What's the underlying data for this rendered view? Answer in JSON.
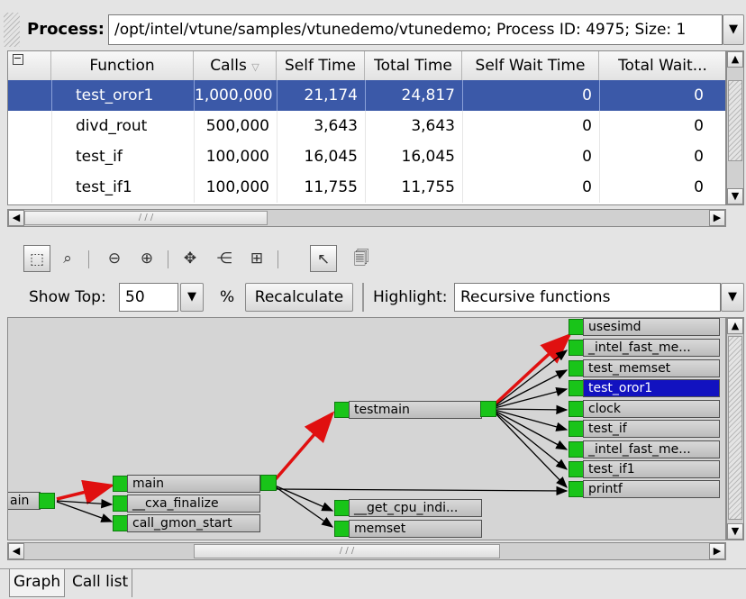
{
  "process": {
    "label": "Process:",
    "value": "/opt/intel/vtune/samples/vtunedemo/vtunedemo; Process ID: 4975; Size: 1"
  },
  "table": {
    "columns": [
      "Function",
      "Calls",
      "Self Time",
      "Total Time",
      "Self Wait Time",
      "Total Wait..."
    ],
    "rows": [
      {
        "function": "test_oror1",
        "calls": "1,000,000",
        "self_time": "21,174",
        "total_time": "24,817",
        "self_wait": "0",
        "total_wait": "0",
        "selected": true
      },
      {
        "function": "divd_rout",
        "calls": "500,000",
        "self_time": "3,643",
        "total_time": "3,643",
        "self_wait": "0",
        "total_wait": "0"
      },
      {
        "function": "test_if",
        "calls": "100,000",
        "self_time": "16,045",
        "total_time": "16,045",
        "self_wait": "0",
        "total_wait": "0"
      },
      {
        "function": "test_if1",
        "calls": "100,000",
        "self_time": "11,755",
        "total_time": "11,755",
        "self_wait": "0",
        "total_wait": "0"
      }
    ]
  },
  "controls": {
    "show_top_label": "Show Top:",
    "show_top_value": "50",
    "percent": "%",
    "recalculate": "Recalculate",
    "highlight_label": "Highlight:",
    "highlight_value": "Recursive functions"
  },
  "graph": {
    "nodes": {
      "ain": "ain",
      "main": "main",
      "cxa_finalize": "__cxa_finalize",
      "call_gmon_start": "call_gmon_start",
      "testmain": "testmain",
      "get_cpu_indi": "__get_cpu_indi...",
      "memset": "memset",
      "usesimd": "usesimd",
      "intel_fast_me1": "_intel_fast_me...",
      "test_memset": "test_memset",
      "test_oror1": "test_oror1",
      "clock": "clock",
      "test_if": "test_if",
      "intel_fast_me2": "_intel_fast_me...",
      "test_if1": "test_if1",
      "printf": "printf"
    },
    "hot_color": "#e01010",
    "node_color": "#19c419",
    "selected_color": "#1212c0"
  },
  "tabs": [
    "Graph",
    "Call list"
  ],
  "icons": [
    "select-rect-icon",
    "zoom-icon",
    "zoom-out-icon",
    "zoom-in-icon",
    "pan-icon",
    "layout-icon",
    "fit-icon",
    "pointer-icon",
    "properties-icon"
  ]
}
